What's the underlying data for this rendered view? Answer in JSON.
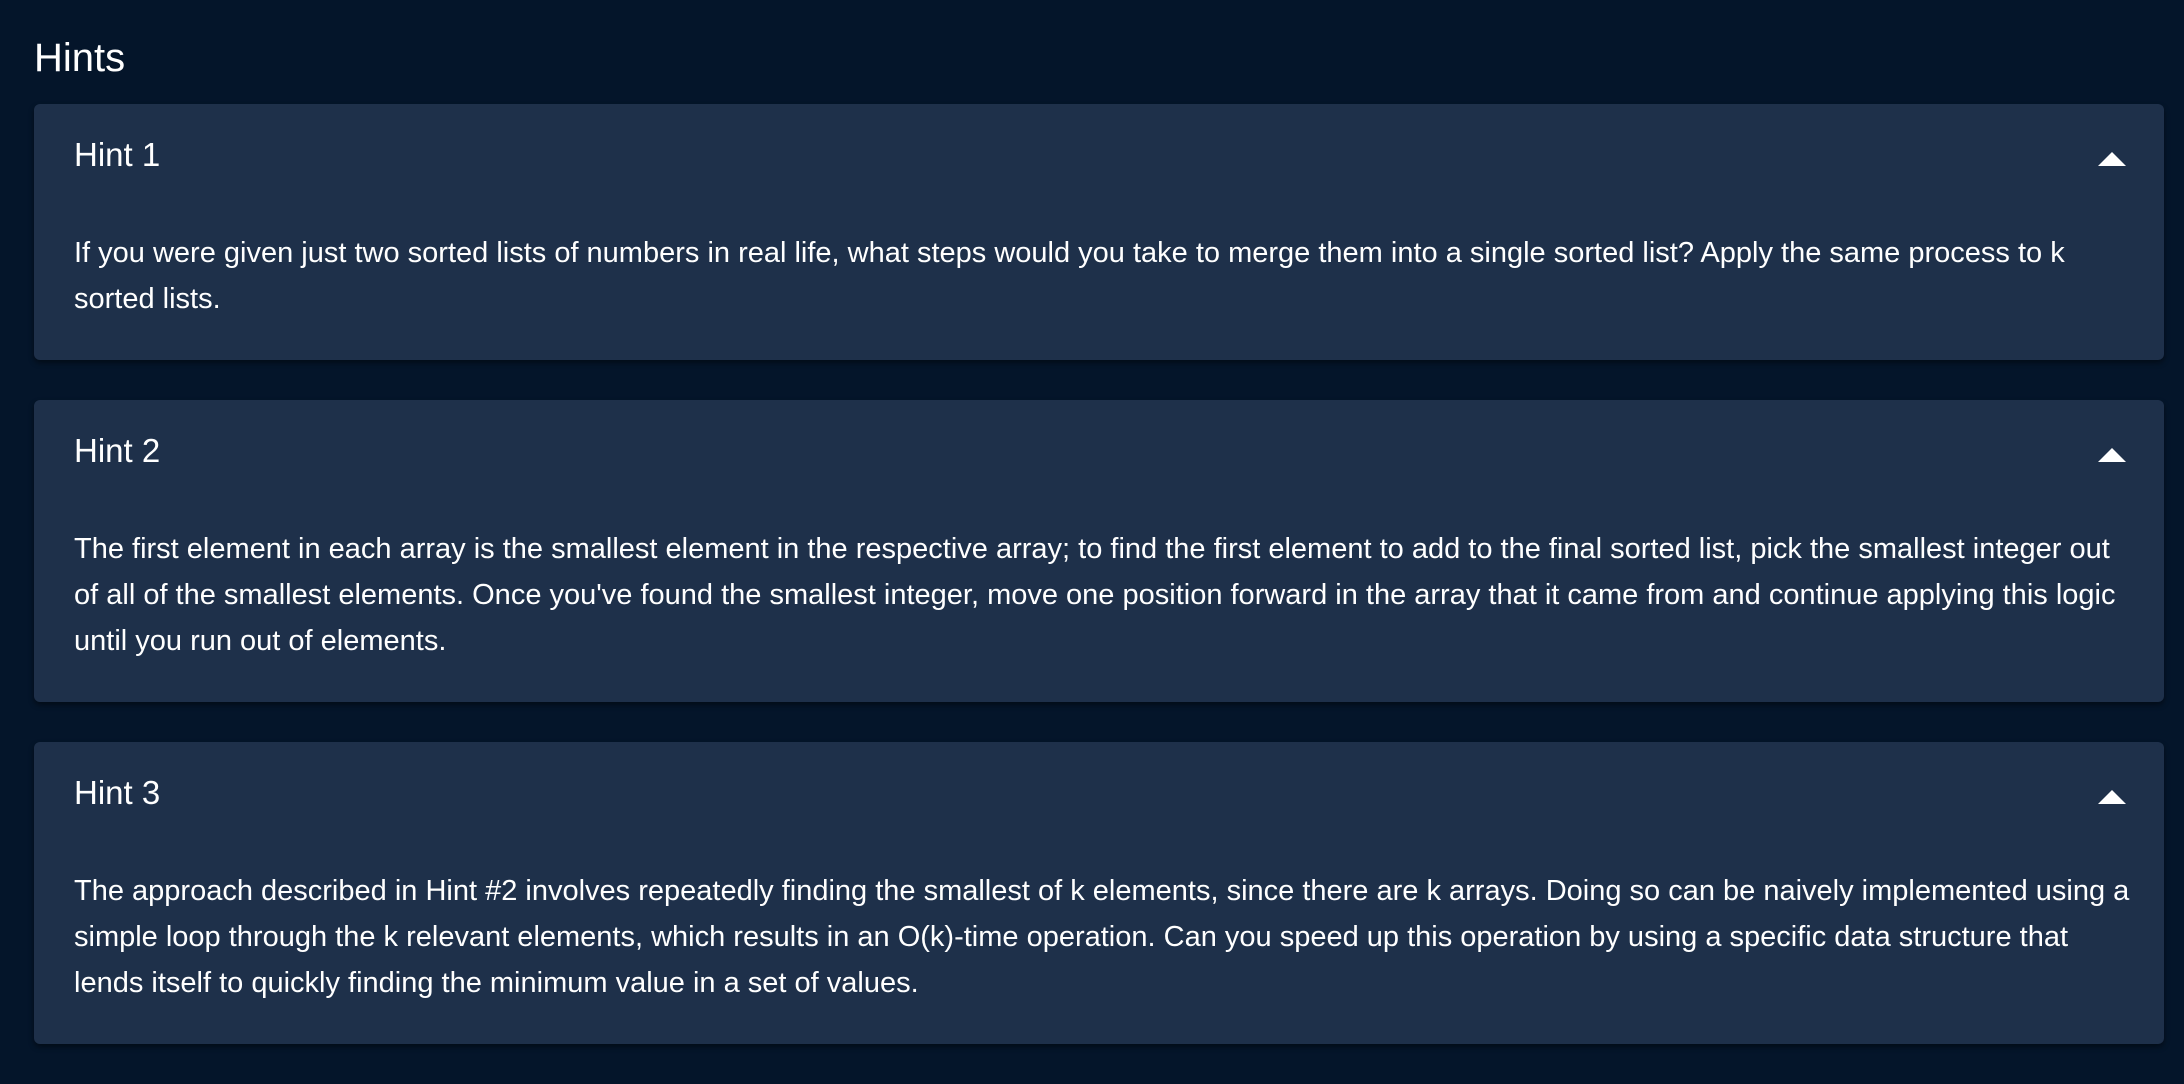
{
  "section": {
    "title": "Hints"
  },
  "hints": [
    {
      "title": "Hint 1",
      "expanded": true,
      "body": "If you were given just two sorted lists of numbers in real life, what steps would you take to merge them into a single sorted list? Apply the same process to k sorted lists."
    },
    {
      "title": "Hint 2",
      "expanded": true,
      "body": "The first element in each array is the smallest element in the respective array; to find the first element to add to the final sorted list, pick the smallest integer out of all of the smallest elements. Once you've found the smallest integer, move one position forward in the array that it came from and continue applying this logic until you run out of elements."
    },
    {
      "title": "Hint 3",
      "expanded": true,
      "body": "The approach described in Hint #2 involves repeatedly finding the smallest of k elements, since there are k arrays. Doing so can be naively implemented using a simple loop through the k relevant elements, which results in an O(k)-time operation. Can you speed up this operation by using a specific data structure that lends itself to quickly finding the minimum value in a set of values."
    }
  ],
  "icons": {
    "toggle": "chevron-up-icon"
  },
  "colors": {
    "background": "#04152a",
    "card": "#1e304a",
    "text": "#ffffff"
  }
}
